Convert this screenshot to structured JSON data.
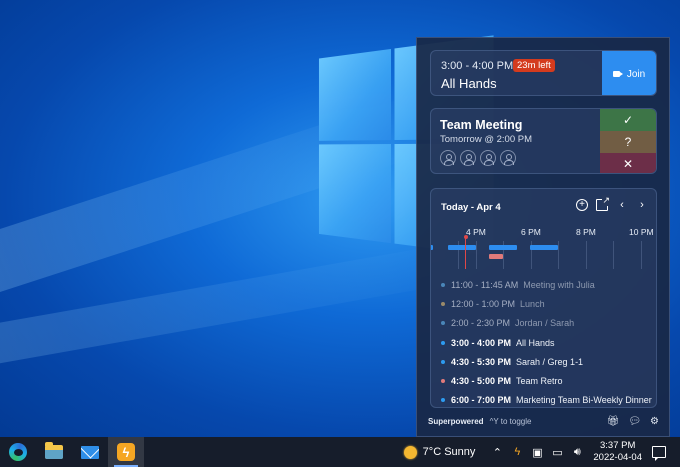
{
  "card_now": {
    "time": "3:00 - 4:00 PM",
    "badge": "23m left",
    "title": "All Hands",
    "join_label": "Join"
  },
  "card_next": {
    "title": "Team Meeting",
    "subtitle": "Tomorrow @ 2:00 PM",
    "attendee_count": 4,
    "rsvp": {
      "yes": "✓",
      "maybe": "?",
      "no": "✕"
    }
  },
  "agenda": {
    "header": "Today - Apr 4",
    "hours": [
      "4 PM",
      "6 PM",
      "8 PM",
      "10 PM"
    ],
    "events": [
      {
        "time": "11:00 - 11:45 AM",
        "title": "Meeting with Julia",
        "state": "past",
        "color": "#4a86b8"
      },
      {
        "time": "12:00 - 1:00 PM",
        "title": "Lunch",
        "state": "past",
        "color": "#9a8a6a"
      },
      {
        "time": "2:00 - 2:30 PM",
        "title": "Jordan / Sarah",
        "state": "past",
        "color": "#4a86b8"
      },
      {
        "time": "3:00 - 4:00 PM",
        "title": "All Hands",
        "state": "upcoming",
        "color": "#2d9bf0"
      },
      {
        "time": "4:30 - 5:30 PM",
        "title": "Sarah / Greg 1-1",
        "state": "upcoming",
        "color": "#2d9bf0"
      },
      {
        "time": "4:30 - 5:00 PM",
        "title": "Team Retro",
        "state": "upcoming",
        "color": "#e07a7a"
      },
      {
        "time": "6:00 - 7:00 PM",
        "title": "Marketing Team Bi-Weekly Dinner",
        "state": "upcoming",
        "color": "#2d9bf0"
      }
    ]
  },
  "footer": {
    "brand": "Superpowered",
    "hint": "^Y to toggle"
  },
  "taskbar": {
    "weather": "7°C  Sunny",
    "time": "3:37 PM",
    "date": "2022-04-04"
  },
  "colors": {
    "join_button": "#2d8df0",
    "badge": "#d43b1e",
    "rsvp_yes": "#3d7547",
    "rsvp_maybe": "#715d44",
    "rsvp_no": "#6c2e48",
    "now_line": "#e04848"
  }
}
